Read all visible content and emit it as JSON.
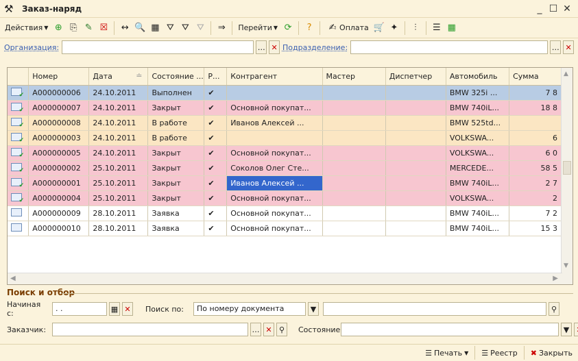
{
  "window": {
    "title": "Заказ-наряд"
  },
  "toolbar": {
    "actions": "Действия",
    "goto": "Перейти",
    "payment": "Оплата"
  },
  "filter": {
    "org_label": "Организация:",
    "dept_label": "Подразделение:"
  },
  "columns": [
    "",
    "Номер",
    "Дата",
    "Состояние ...",
    "Р...",
    "Контрагент",
    "Мастер",
    "Диспетчер",
    "Автомобиль",
    "Сумма"
  ],
  "rows": [
    {
      "cls": "r-blue",
      "icon": "ok",
      "num": "А000000006",
      "date": "24.10.2011",
      "state": "Выполнен",
      "r": "✔",
      "kontr": "",
      "master": "",
      "disp": "",
      "auto": "BMW 325i ...",
      "sum": "7 8"
    },
    {
      "cls": "r-pink",
      "icon": "ok",
      "num": "А000000007",
      "date": "24.10.2011",
      "state": "Закрыт",
      "r": "✔",
      "kontr": "Основной покупат...",
      "master": "",
      "disp": "",
      "auto": "BMW 740iL...",
      "sum": "18 8"
    },
    {
      "cls": "r-cream",
      "icon": "ok",
      "num": "А000000008",
      "date": "24.10.2011",
      "state": "В работе",
      "r": "✔",
      "kontr": "Иванов Алексей ...",
      "master": "",
      "disp": "",
      "auto": "BMW 525td...",
      "sum": ""
    },
    {
      "cls": "r-cream",
      "icon": "ok",
      "num": "А000000003",
      "date": "24.10.2011",
      "state": "В работе",
      "r": "✔",
      "kontr": "",
      "master": "",
      "disp": "",
      "auto": "VOLKSWA...",
      "sum": "6"
    },
    {
      "cls": "r-pink",
      "icon": "ok",
      "num": "А000000005",
      "date": "24.10.2011",
      "state": "Закрыт",
      "r": "✔",
      "kontr": "Основной покупат...",
      "master": "",
      "disp": "",
      "auto": "VOLKSWA...",
      "sum": "6 0"
    },
    {
      "cls": "r-pink",
      "icon": "ok",
      "num": "А000000002",
      "date": "25.10.2011",
      "state": "Закрыт",
      "r": "✔",
      "kontr": "Соколов Олег Сте...",
      "master": "",
      "disp": "",
      "auto": "MERCEDE...",
      "sum": "58 5"
    },
    {
      "cls": "r-pink",
      "icon": "ok",
      "num": "А000000001",
      "date": "25.10.2011",
      "state": "Закрыт",
      "r": "✔",
      "kontr": "Иванов Алексей ...",
      "master": "",
      "disp": "",
      "auto": "BMW 740iL...",
      "sum": "2 7",
      "sel": true
    },
    {
      "cls": "r-pink",
      "icon": "ok",
      "num": "А000000004",
      "date": "25.10.2011",
      "state": "Закрыт",
      "r": "✔",
      "kontr": "Основной покупат...",
      "master": "",
      "disp": "",
      "auto": "VOLKSWA...",
      "sum": "2"
    },
    {
      "cls": "r-white",
      "icon": "plain",
      "num": "А000000009",
      "date": "28.10.2011",
      "state": "Заявка",
      "r": "✔",
      "kontr": "Основной покупат...",
      "master": "",
      "disp": "",
      "auto": "BMW 740iL...",
      "sum": "7 2"
    },
    {
      "cls": "r-white",
      "icon": "plain",
      "num": "А000000010",
      "date": "28.10.2011",
      "state": "Заявка",
      "r": "✔",
      "kontr": "Основной покупат...",
      "master": "",
      "disp": "",
      "auto": "BMW 740iL...",
      "sum": "15 3"
    }
  ],
  "search": {
    "title": "Поиск и отбор",
    "from_label": "Начиная с:",
    "from_value": ". .",
    "by_label": "Поиск по:",
    "by_value": "По номеру документа",
    "customer_label": "Заказчик:",
    "state_label": "Состояние:"
  },
  "footer": {
    "print": "Печать",
    "registry": "Реестр",
    "close": "Закрыть"
  }
}
